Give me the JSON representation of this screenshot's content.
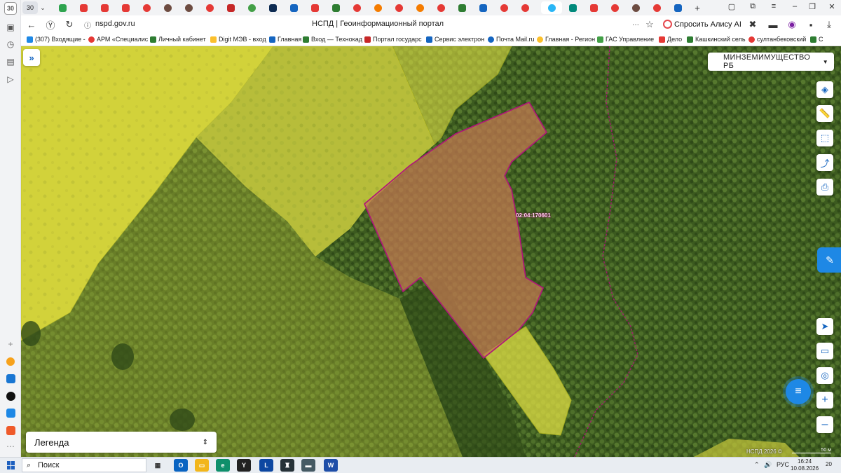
{
  "browser": {
    "tab_count": "30",
    "url": "nspd.gov.ru",
    "page_title": "НСПД | Геоинформационный портал",
    "alice_label": "Спросить Алису AI",
    "more": "···",
    "bookmarks": [
      "(307) Входящие -",
      "АРМ «Специалис",
      "Личный кабинет",
      "Digit МЭВ - вход",
      "Главная",
      "Вход — Технокад",
      "Портал государс",
      "Сервис электрон",
      "Почта Mail.ru",
      "Главная - Регион",
      "ГАС Управление",
      "Дело",
      "Кашкинский сель",
      "султанбековский",
      "С"
    ]
  },
  "map": {
    "org_selector": "МИНЗЕМИМУЩЕСТВО РБ",
    "legend_label": "Легенда",
    "parcel_label": "02:04:170601",
    "copyright": "НСПД 2026 ©",
    "scale": "50 м"
  },
  "taskbar": {
    "search_label": "Поиск",
    "lang": "РУС",
    "time": "16:24",
    "date": "10.08.2026",
    "notif_count": "20"
  },
  "colors": {
    "parcel_border": "#b0137a",
    "parcel_fill": "#c07850",
    "zone_fill": "#dcdc3c",
    "accent": "#1e88e5"
  }
}
